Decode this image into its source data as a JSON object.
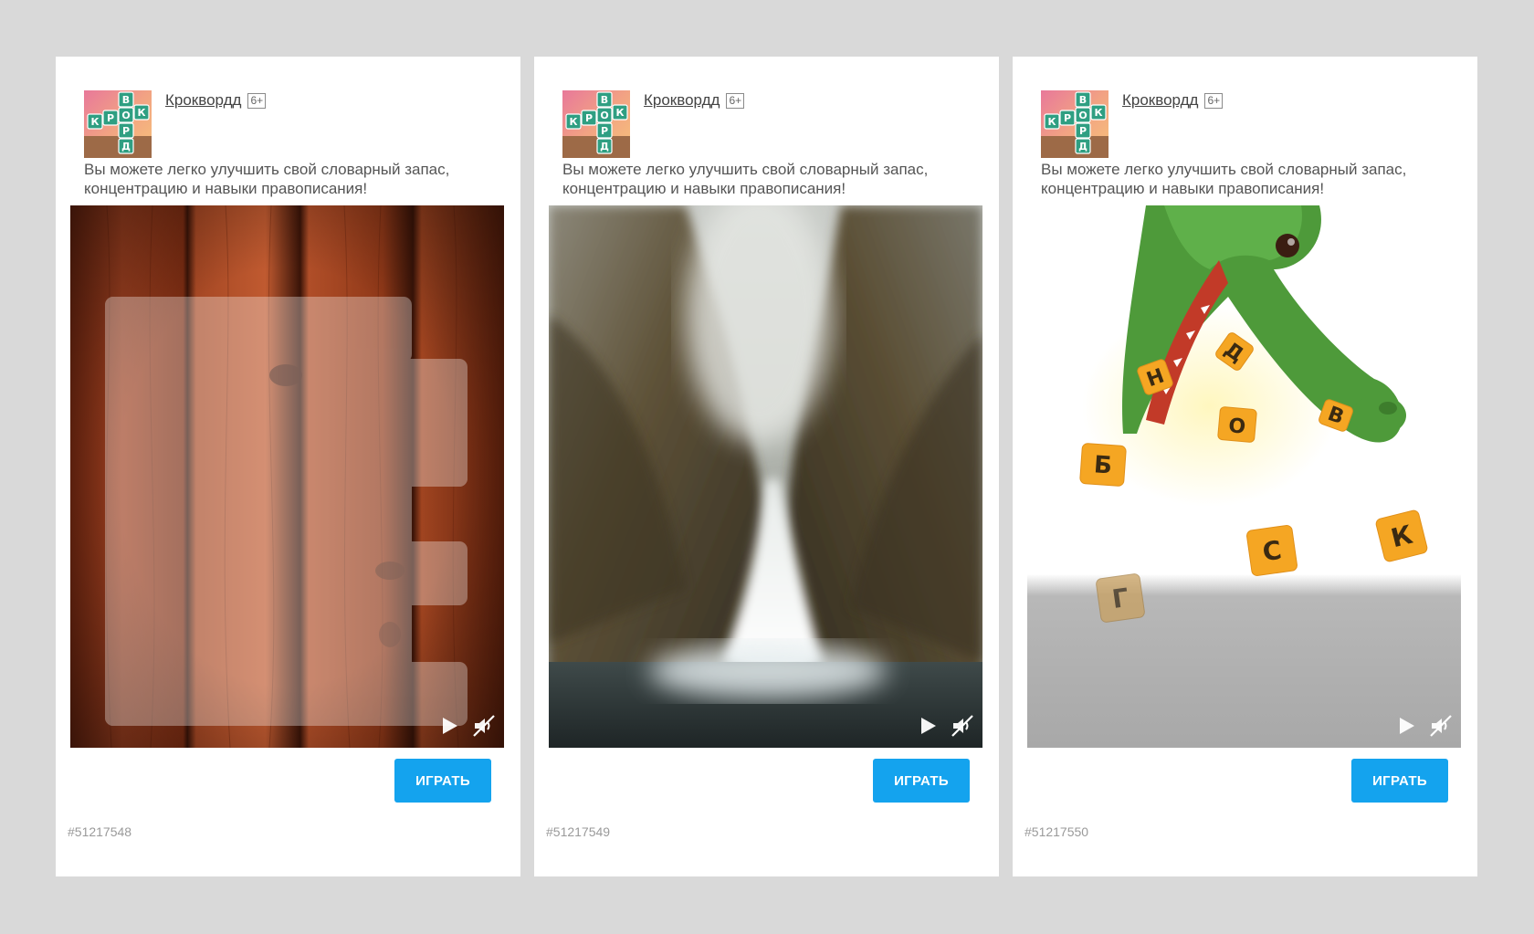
{
  "colors": {
    "page_background": "#d9d9d9",
    "card_background": "#ffffff",
    "button_color": "#14a3ee",
    "logo_tile_green": "#2f9f82"
  },
  "logo": {
    "horizontal_letters": [
      "К",
      "Р",
      "О",
      "К"
    ],
    "vertical_letters": [
      "В",
      "О",
      "Р",
      "Д"
    ]
  },
  "cards": [
    {
      "app_name": "Кроквордд",
      "age_rating": "6+",
      "description": "Вы можете легко улучшить свой словарный запас, концентрацию и навыки правописания!",
      "button_label": "ИГРАТЬ",
      "ad_id": "#51217548",
      "media_type": "wooden-board-video",
      "controls": [
        "play-icon",
        "mute-icon"
      ]
    },
    {
      "app_name": "Кроквордд",
      "age_rating": "6+",
      "description": "Вы можете легко улучшить свой словарный запас, концентрацию и навыки правописания!",
      "button_label": "ИГРАТЬ",
      "ad_id": "#51217549",
      "media_type": "waterfall-video",
      "controls": [
        "play-icon",
        "mute-icon"
      ]
    },
    {
      "app_name": "Кроквордд",
      "age_rating": "6+",
      "description": "Вы можете легко улучшить свой словарный запас, концентрацию и навыки правописания!",
      "button_label": "ИГРАТЬ",
      "ad_id": "#51217550",
      "media_type": "crocodile-letters-video",
      "falling_letters": [
        "Н",
        "Д",
        "О",
        "В",
        "Б",
        "С",
        "К",
        "Г"
      ],
      "controls": [
        "play-icon",
        "mute-icon"
      ]
    }
  ]
}
